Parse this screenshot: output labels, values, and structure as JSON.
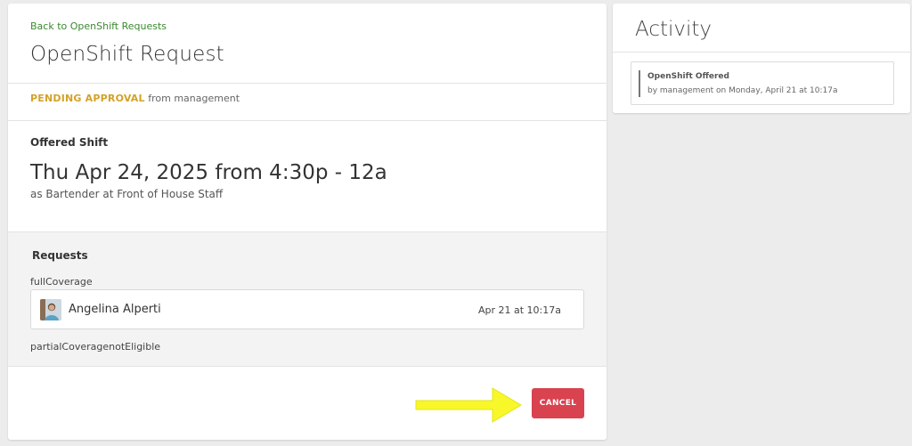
{
  "header": {
    "back_link": "Back to OpenShift Requests",
    "title": "OpenShift Request"
  },
  "status": {
    "badge": "PENDING APPROVAL",
    "detail": "from management",
    "badge_color": "#d3a229"
  },
  "shift": {
    "section_label": "Offered Shift",
    "time": "Thu Apr 24, 2025 from 4:30p - 12a",
    "role": "as Bartender at Front of House Staff"
  },
  "requests": {
    "title": "Requests",
    "full_coverage_label": "fullCoverage",
    "items": [
      {
        "name": "Angelina Alperti",
        "time": "Apr 21 at 10:17a",
        "avatar_icon": "person-avatar-icon"
      }
    ],
    "partial_label": "partialCoveragenotEligible"
  },
  "actions": {
    "cancel_label": "CANCEL",
    "cancel_color": "#d8434f",
    "annotation_color": "#f7f72a"
  },
  "activity": {
    "title": "Activity",
    "items": [
      {
        "title": "OpenShift Offered",
        "detail": "by management on Monday, April 21 at 10:17a"
      }
    ]
  },
  "colors": {
    "link_green": "#3a8a2e",
    "page_bg": "#ececec"
  }
}
